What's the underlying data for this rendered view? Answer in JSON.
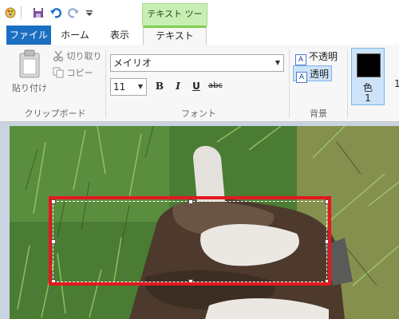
{
  "colors": {
    "accent": "#1b6fc2",
    "context_tab": "#7ed14f",
    "highlight": "#e3191f"
  },
  "quick_access": {
    "icons": [
      "paint-app-icon",
      "save-icon",
      "undo-icon",
      "redo-icon",
      "customize-dropdown-icon"
    ]
  },
  "context_group": {
    "label": "テキスト ツール"
  },
  "tabs": {
    "file": "ファイル",
    "home": "ホーム",
    "view": "表示",
    "text": "テキスト"
  },
  "clipboard": {
    "paste": "貼り付け",
    "cut": "切り取り",
    "copy": "コピー",
    "group_label": "クリップボード"
  },
  "font": {
    "family": "メイリオ",
    "size": "11",
    "bold": "B",
    "italic": "I",
    "underline": "U",
    "strike": "abc",
    "group_label": "フォント"
  },
  "background": {
    "opaque": "不透明",
    "transparent": "透明",
    "group_label": "背景",
    "selected": "transparent"
  },
  "color": {
    "label1": "色",
    "label2": "1",
    "next": "1",
    "value": "#000000"
  }
}
